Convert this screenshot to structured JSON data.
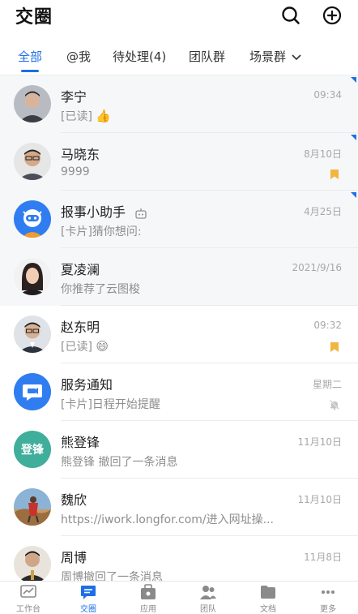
{
  "header": {
    "title": "交圈",
    "search_icon": "search-icon",
    "add_icon": "plus-circle-icon"
  },
  "tabs": [
    {
      "label": "全部",
      "active": true
    },
    {
      "label": "@我",
      "active": false
    },
    {
      "label": "待处理(4)",
      "active": false
    },
    {
      "label": "团队群",
      "active": false
    },
    {
      "label": "场景群",
      "active": false
    }
  ],
  "conversations": [
    {
      "name": "李宁",
      "preview": "[已读]",
      "preview_emoji": "👍",
      "time": "09:34",
      "pinned": true,
      "unread_corner": true,
      "avatar": "photo-man-glasses"
    },
    {
      "name": "马晓东",
      "preview": "9999",
      "time": "8月10日",
      "pinned": true,
      "unread_corner": true,
      "bookmark": true,
      "avatar": "photo-man-glasses"
    },
    {
      "name": "报事小助手",
      "name_badge": "robot-icon",
      "preview": "[卡片]猜你想问:",
      "time": "4月25日",
      "pinned": true,
      "unread_corner": true,
      "avatar": "robot-mascot"
    },
    {
      "name": "夏凌澜",
      "preview": "你推荐了云图梭",
      "time": "2021/9/16",
      "pinned": true,
      "unread_corner": false,
      "avatar": "photo-woman"
    },
    {
      "name": "赵东明",
      "preview": "[已读]",
      "preview_emoji": "😄",
      "time": "09:32",
      "pinned": false,
      "bookmark": true,
      "avatar": "photo-man-glasses"
    },
    {
      "name": "服务通知",
      "preview": "[卡片]日程开始提醒",
      "time": "星期二",
      "pinned": false,
      "muted": true,
      "avatar": "service-notice"
    },
    {
      "name": "熊登锋",
      "preview": "熊登锋 撤回了一条消息",
      "time": "11月10日",
      "pinned": false,
      "avatar": "text-avatar",
      "avatar_text": "登锋",
      "avatar_color": "#3fae9b"
    },
    {
      "name": "魏欣",
      "preview": "https://iwork.longfor.com/进入网址操...",
      "time": "11月10日",
      "pinned": false,
      "avatar": "photo-outdoor"
    },
    {
      "name": "周博",
      "preview": "周博撤回了一条消息",
      "time": "11月8日",
      "pinned": false,
      "avatar": "photo-man-suit"
    }
  ],
  "bottom_nav": [
    {
      "label": "工作台",
      "icon": "chart-icon",
      "active": false
    },
    {
      "label": "交圈",
      "icon": "chat-icon",
      "active": true
    },
    {
      "label": "应用",
      "icon": "apps-icon",
      "active": false
    },
    {
      "label": "团队",
      "icon": "team-icon",
      "active": false
    },
    {
      "label": "文档",
      "icon": "folder-icon",
      "active": false
    },
    {
      "label": "更多",
      "icon": "more-icon",
      "active": false
    }
  ],
  "colors": {
    "accent": "#1e6fe6",
    "bookmark": "#f2b640",
    "pinned_bg": "#f6f7f8"
  }
}
